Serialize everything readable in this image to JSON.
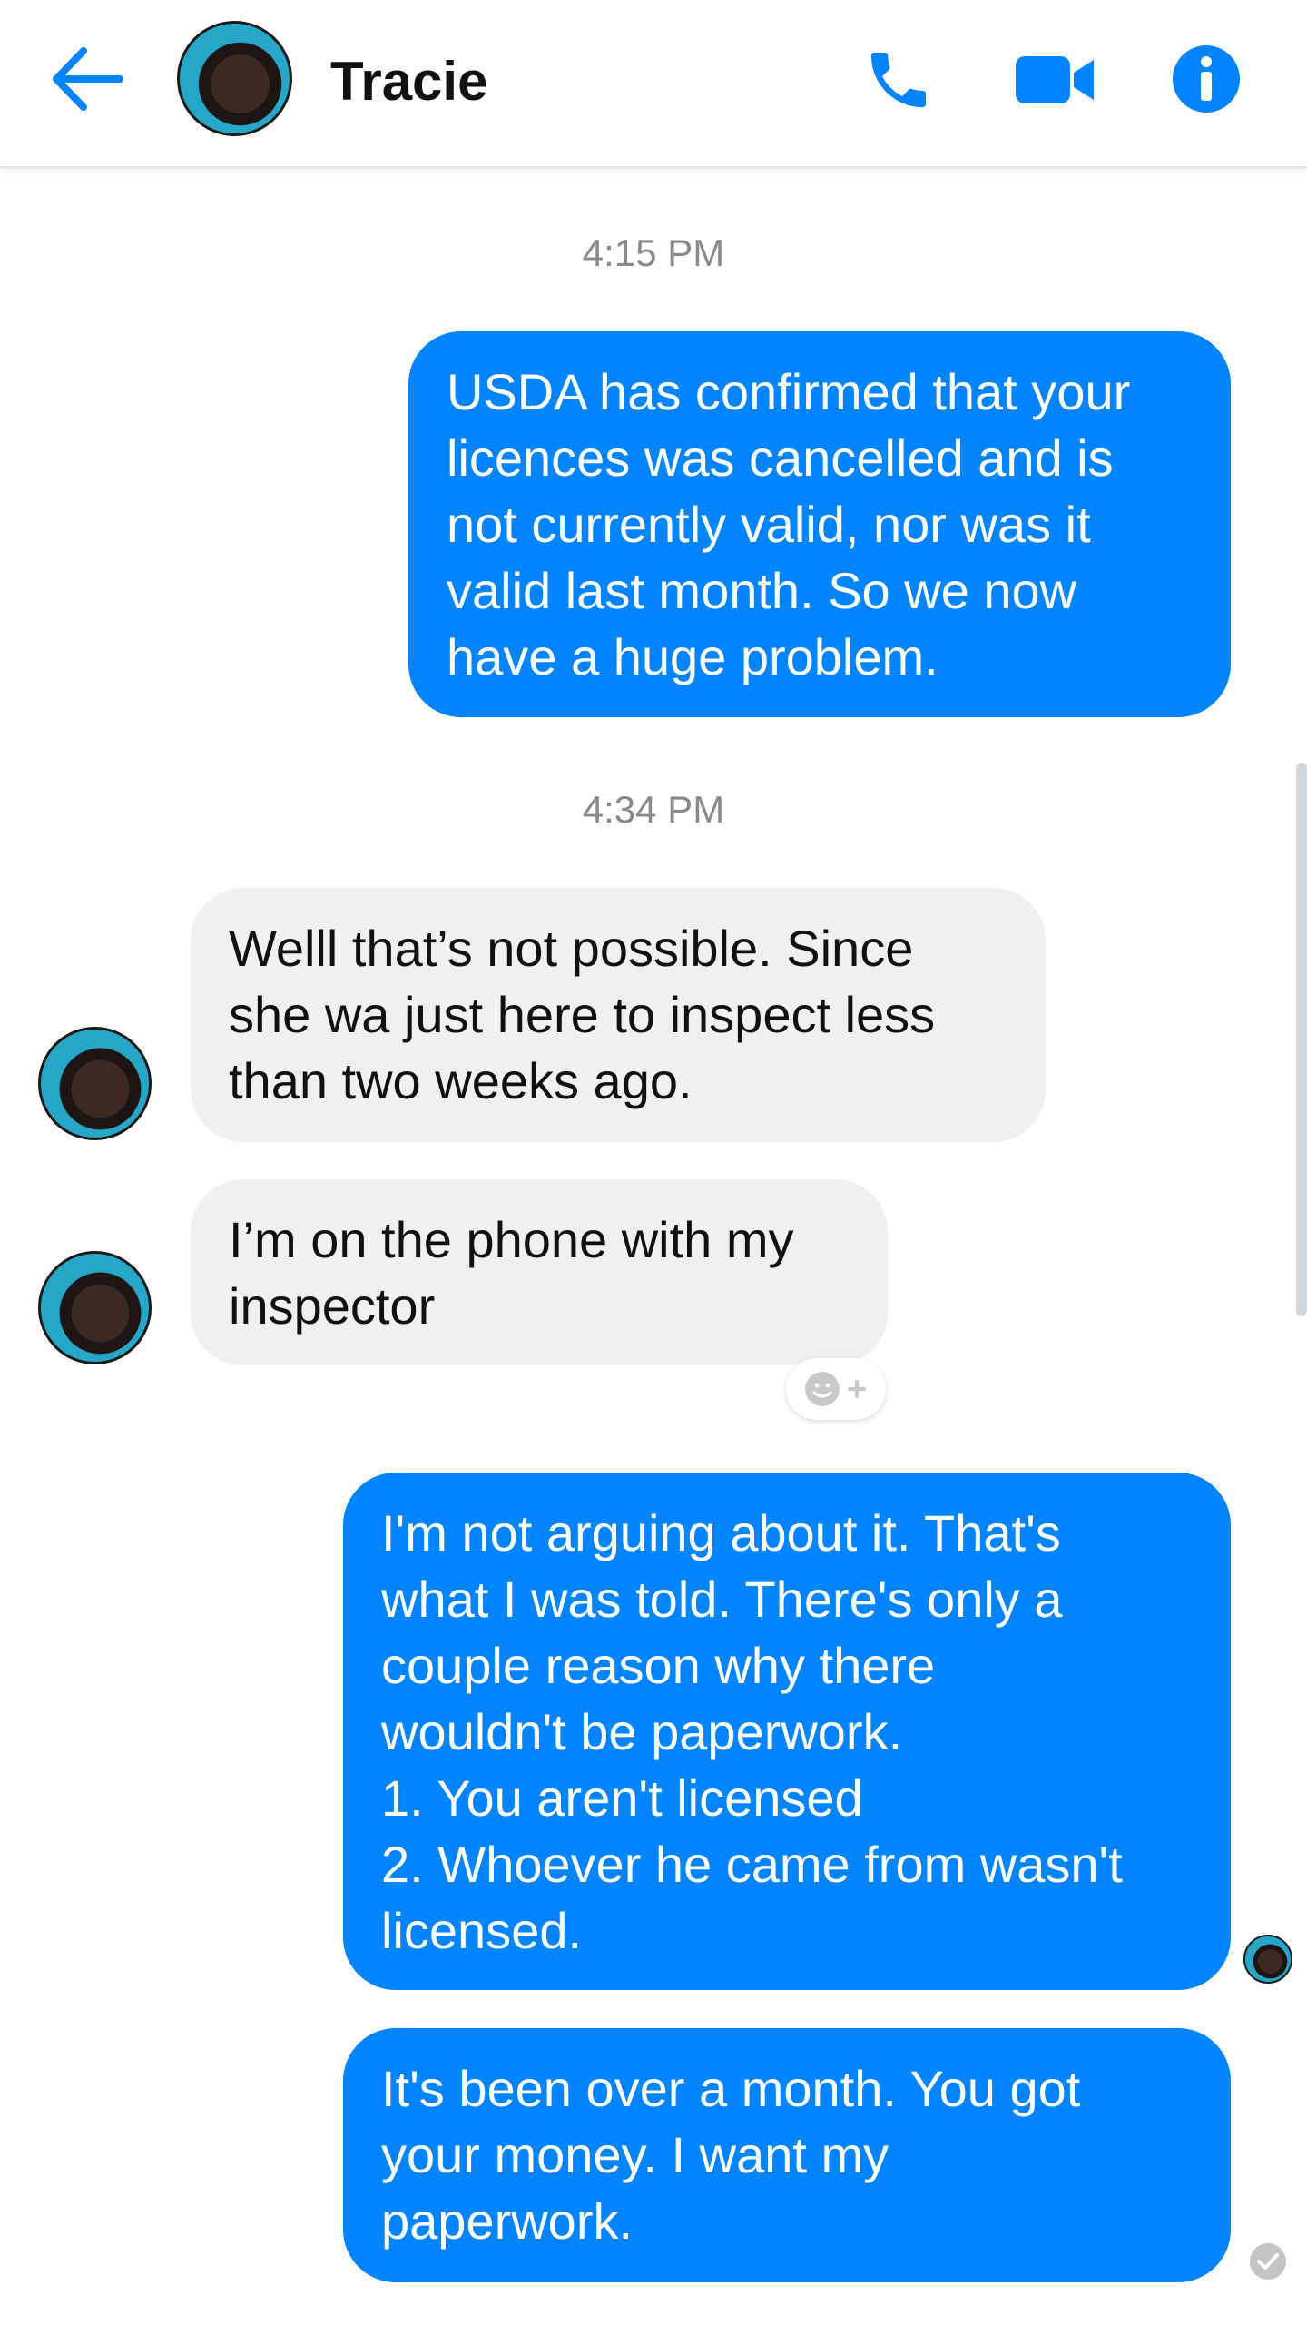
{
  "header": {
    "contact_name": "Tracie",
    "icons": {
      "back": "back-arrow-icon",
      "phone": "phone-icon",
      "video": "video-camera-icon",
      "info": "info-icon"
    }
  },
  "colors": {
    "accent": "#0084ff",
    "outgoing_bubble": "#0084ff",
    "incoming_bubble": "#f0f0f0",
    "timestamp_text": "#8a8a8a"
  },
  "conversation": {
    "timestamps": [
      "4:15 PM",
      "4:34 PM"
    ],
    "messages": [
      {
        "from": "me",
        "text": "USDA has confirmed that your\nlicences was cancelled and is\nnot currently valid, nor was it\nvalid last month. So we now\nhave a huge problem."
      },
      {
        "from": "Tracie",
        "text": "Welll that’s not possible. Since\nshe wa just here to inspect less\nthan two weeks ago."
      },
      {
        "from": "Tracie",
        "text": "I’m on the phone with my\ninspector"
      },
      {
        "from": "me",
        "text": "I'm not arguing about it. That's\nwhat I was told. There's only a\ncouple reason why there\nwouldn't be paperwork.\n1. You aren't licensed\n2. Whoever he came from wasn't\nlicensed."
      },
      {
        "from": "me",
        "text": "It's been over a month. You got\nyour money. I want my\npaperwork."
      }
    ]
  }
}
